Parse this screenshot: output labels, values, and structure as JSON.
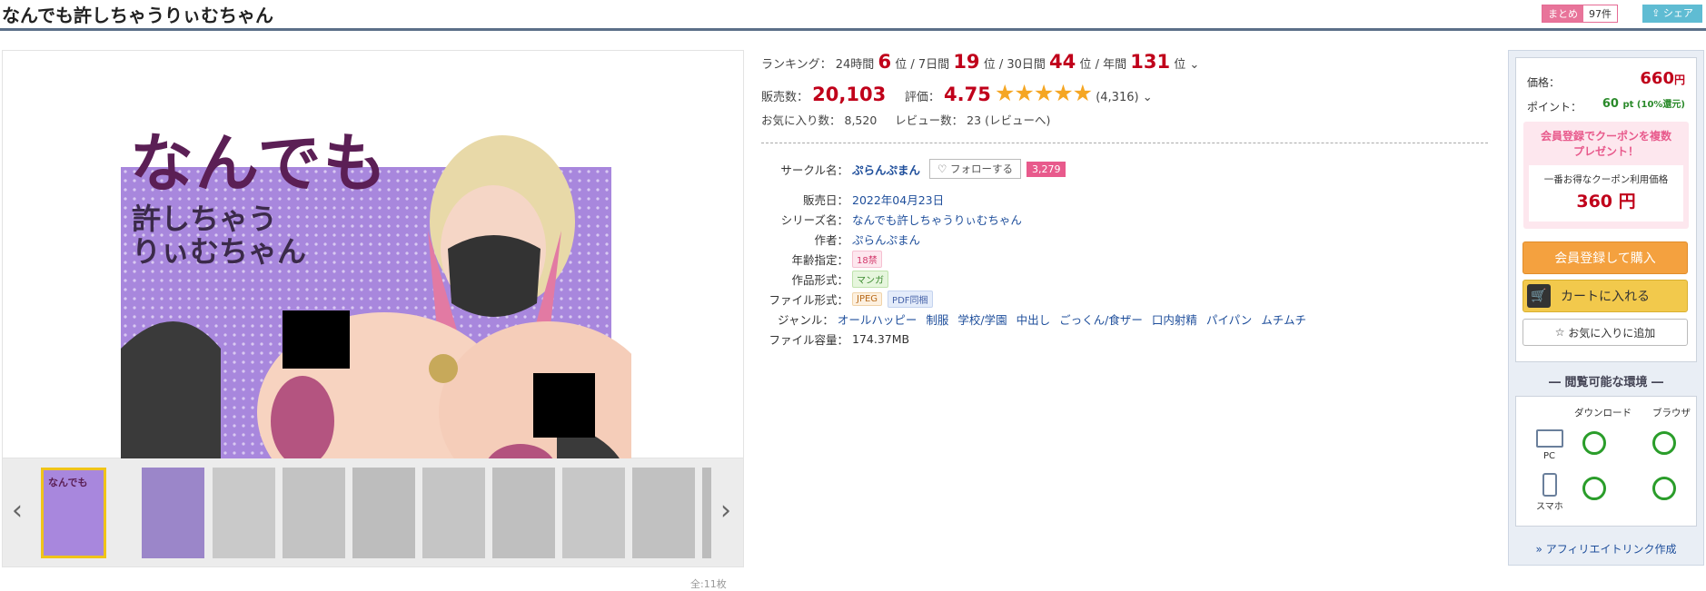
{
  "header": {
    "title": "なんでも許しちゃうりぃむちゃん",
    "matome_label": "まとめ",
    "matome_count": "97件",
    "share_label": "シェア"
  },
  "gallery": {
    "cover_title_1": "なんでも",
    "cover_title_2": "許しちゃう",
    "cover_title_3": "りぃむちゃん",
    "count": "全:11枚",
    "thumb_count": 10
  },
  "ranking": {
    "label": "ランキング：",
    "d24_label": "24時間",
    "d24": "6",
    "d7_label": "7日間",
    "d7": "19",
    "d30_label": "30日間",
    "d30": "44",
    "year_label": "年間",
    "year": "131",
    "unit": "位"
  },
  "sales": {
    "label": "販売数：",
    "value": "20,103",
    "rating_label": "評価：",
    "rating": "4.75",
    "stars": "★★★★★",
    "rating_count": "(4,316)"
  },
  "fav": {
    "label": "お気に入り数：",
    "value": "8,520",
    "review_label": "レビュー数：",
    "review_value": "23",
    "review_link": "(レビューへ)"
  },
  "details": {
    "circle_label": "サークル名：",
    "circle": "ぷらんぷまん",
    "follow": "フォローする",
    "follow_count": "3,279",
    "release_label": "販売日：",
    "release": "2022年04月23日",
    "series_label": "シリーズ名：",
    "series": "なんでも許しちゃうりぃむちゃん",
    "author_label": "作者：",
    "author": "ぷらんぷまん",
    "age_label": "年齢指定：",
    "age": "18禁",
    "format_label": "作品形式：",
    "format": "マンガ",
    "file_label": "ファイル形式：",
    "file1": "JPEG",
    "file2": "PDF同梱",
    "genre_label": "ジャンル：",
    "genres": [
      "オールハッピー",
      "制服",
      "学校/学園",
      "中出し",
      "ごっくん/食ザー",
      "口内射精",
      "パイパン",
      "ムチムチ"
    ],
    "size_label": "ファイル容量：",
    "size": "174.37MB"
  },
  "buy": {
    "price_label": "価格：",
    "price": "660",
    "price_unit": "円",
    "point_label": "ポイント：",
    "point": "60",
    "point_unit": "pt (10%還元)",
    "coupon_title_1": "会員登録でクーポンを複数",
    "coupon_title_2": "プレゼント！",
    "coupon_sub": "一番お得なクーポン利用価格",
    "coupon_price": "360 円",
    "register_btn": "会員登録して購入",
    "cart_btn": "カートに入れる",
    "fav_btn": "お気に入りに追加"
  },
  "env": {
    "title": "閲覧可能な環境",
    "col_dl": "ダウンロード",
    "col_browser": "ブラウザ",
    "row_pc": "PC",
    "row_phone": "スマホ",
    "affiliate": "アフィリエイトリンク作成"
  },
  "colors": {
    "accent_red": "#c0001a",
    "link": "#1e4e9b",
    "star": "#f5a623",
    "cart": "#f2c94c",
    "register": "#f4a13f"
  }
}
